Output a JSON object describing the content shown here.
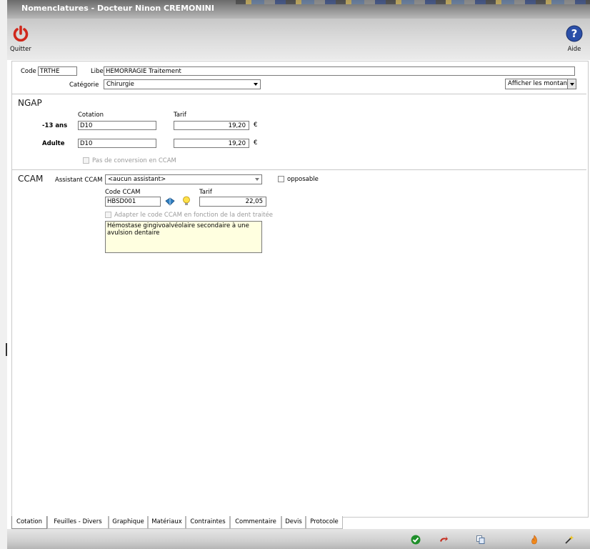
{
  "window": {
    "title": "Nomenclatures - Docteur Ninon CREMONINI"
  },
  "toolbar": {
    "quit_label": "Quitter",
    "help_label": "Aide"
  },
  "header": {
    "code_label": "Code",
    "code_value": "TRTHE",
    "libelle_label": "Libellé",
    "libelle_value": "HEMORRAGIE Traitement",
    "categorie_label": "Catégorie",
    "categorie_value": "Chirurgie",
    "display_select": "Afficher les montant"
  },
  "ngap": {
    "title": "NGAP",
    "cotation_header": "Cotation",
    "tarif_header": "Tarif",
    "rows": [
      {
        "label": "-13 ans",
        "cotation": "D10",
        "tarif": "19,20",
        "currency": "€"
      },
      {
        "label": "Adulte",
        "cotation": "D10",
        "tarif": "19,20",
        "currency": "€"
      }
    ],
    "no_conversion_label": "Pas de conversion en CCAM"
  },
  "ccam": {
    "title": "CCAM",
    "assistant_label": "Assistant CCAM",
    "assistant_value": "<aucun assistant>",
    "opposable_label": "opposable",
    "code_header": "Code CCAM",
    "tarif_header": "Tarif",
    "code_value": "HBSD001",
    "tarif_value": "22,05",
    "adapt_label": "Adapter le code CCAM en fonction de la dent traitée",
    "description": "Hémostase gingivoalvéolaire secondaire à une avulsion dentaire"
  },
  "tabs": [
    "Cotation",
    "Feuilles - Divers",
    "Graphique",
    "Matériaux",
    "Contraintes",
    "Commentaire",
    "Devis",
    "Protocole"
  ],
  "colors": {
    "accent_red": "#d0281c",
    "help_blue": "#2b4fa8",
    "note_bg": "#ffffe0"
  }
}
